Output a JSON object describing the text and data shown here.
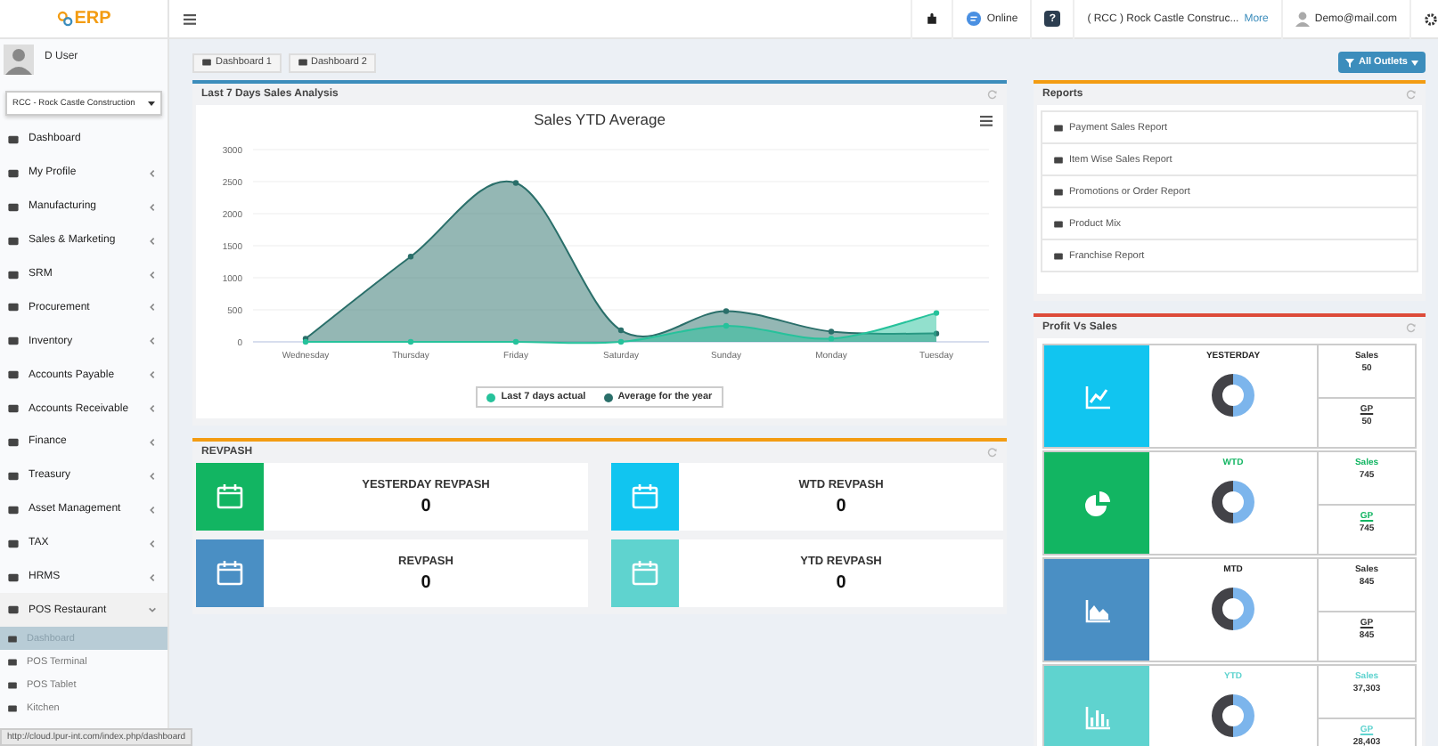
{
  "logo": {
    "text": "ERP"
  },
  "user": {
    "name": "D User"
  },
  "company_select": {
    "value": "RCC - Rock Castle Construction"
  },
  "sidebar": {
    "items": [
      {
        "label": "Dashboard"
      },
      {
        "label": "My Profile",
        "expanded": false
      },
      {
        "label": "Manufacturing",
        "expanded": false
      },
      {
        "label": "Sales & Marketing",
        "expanded": false
      },
      {
        "label": "SRM",
        "expanded": false
      },
      {
        "label": "Procurement",
        "expanded": false
      },
      {
        "label": "Inventory",
        "expanded": false
      },
      {
        "label": "Accounts Payable",
        "expanded": false
      },
      {
        "label": "Accounts Receivable",
        "expanded": false
      },
      {
        "label": "Finance",
        "expanded": false
      },
      {
        "label": "Treasury",
        "expanded": false
      },
      {
        "label": "Asset Management",
        "expanded": false
      },
      {
        "label": "TAX",
        "expanded": false
      },
      {
        "label": "HRMS",
        "expanded": false
      },
      {
        "label": "POS Restaurant",
        "expanded": true,
        "children": [
          {
            "label": "Dashboard",
            "selected": true
          },
          {
            "label": "POS Terminal",
            "selected": false
          },
          {
            "label": "POS Tablet",
            "selected": false
          },
          {
            "label": "Kitchen",
            "selected": false
          }
        ]
      }
    ]
  },
  "topbar": {
    "status": "Online",
    "help": "?",
    "company": "( RCC ) Rock Castle Construc...",
    "more_link": "More",
    "email": "Demo@mail.com"
  },
  "tabs": [
    {
      "label": "Dashboard 1",
      "selected": false
    },
    {
      "label": "Dashboard 2",
      "selected": false
    }
  ],
  "filter_button": "All Outlets",
  "sales_panel": {
    "title": "Last 7 Days Sales Analysis",
    "chart_data": {
      "type": "area",
      "title": "Sales YTD Average",
      "categories": [
        "Wednesday",
        "Thursday",
        "Friday",
        "Saturday",
        "Sunday",
        "Monday",
        "Tuesday"
      ],
      "ylim": [
        0,
        3000
      ],
      "grid": true,
      "yticks": [
        0,
        500,
        1000,
        1500,
        2000,
        2500,
        3000
      ],
      "series": [
        {
          "name": "Last 7 days actual",
          "color": "#26c29b",
          "values": [
            0,
            0,
            0,
            0,
            250,
            50,
            450
          ]
        },
        {
          "name": "Average for the year",
          "color": "#2a6f6a",
          "values": [
            50,
            1330,
            2480,
            180,
            480,
            160,
            130
          ]
        }
      ]
    }
  },
  "revpash": {
    "title": "REVPASH",
    "tiles": [
      {
        "label": "YESTERDAY REVPASH",
        "value": "0",
        "color": "#12b562"
      },
      {
        "label": "WTD REVPASH",
        "value": "0",
        "color": "#11c5f0"
      },
      {
        "label": "REVPASH",
        "value": "0",
        "color": "#4a8fc4"
      },
      {
        "label": "YTD REVPASH",
        "value": "0",
        "color": "#5fd3cf"
      }
    ]
  },
  "reports": {
    "title": "Reports",
    "items": [
      "Payment Sales Report",
      "Item Wise Sales Report",
      "Promotions or Order Report",
      "Product Mix",
      "Franchise Report"
    ]
  },
  "profit_vs_sales": {
    "title": "Profit Vs Sales",
    "rows": [
      {
        "period": "YESTERDAY",
        "color": "#11c5f0",
        "highlight": false,
        "sales_label": "Sales",
        "sales": "50",
        "gp_label": "GP",
        "gp": "50"
      },
      {
        "period": "WTD",
        "color": "#12b562",
        "highlight": true,
        "sales_label": "Sales",
        "sales": "745",
        "gp_label": "GP",
        "gp": "745"
      },
      {
        "period": "MTD",
        "color": "#4a8fc4",
        "highlight": false,
        "sales_label": "Sales",
        "sales": "845",
        "gp_label": "GP",
        "gp": "845"
      },
      {
        "period": "YTD",
        "color": "#5fd3cf",
        "highlight": true,
        "sales_label": "Sales",
        "sales": "37,303",
        "gp_label": "GP",
        "gp": "28,403"
      }
    ]
  },
  "status_url": "http://cloud.lpur-int.com/index.php/dashboard"
}
